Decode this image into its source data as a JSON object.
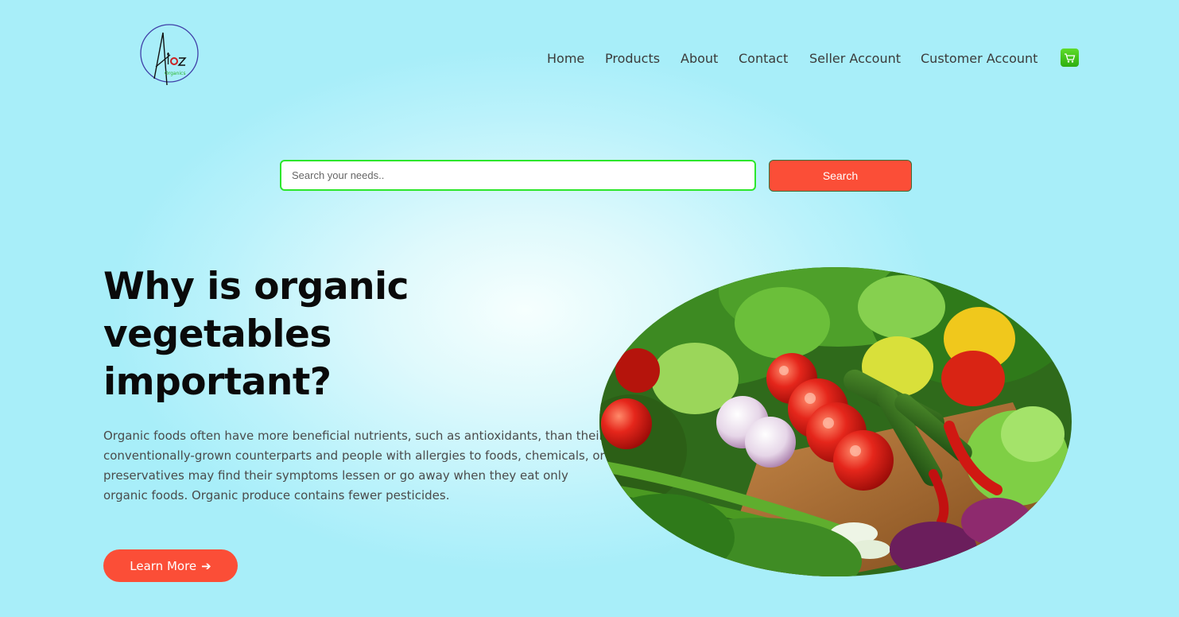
{
  "brand": {
    "logo_main": "Atoz",
    "logo_sub": "Organics"
  },
  "nav": {
    "items": [
      {
        "label": "Home"
      },
      {
        "label": "Products"
      },
      {
        "label": "About"
      },
      {
        "label": "Contact"
      },
      {
        "label": "Seller Account"
      },
      {
        "label": "Customer Account"
      }
    ],
    "cart_icon": "shopping-cart-icon"
  },
  "search": {
    "placeholder": "Search your needs..",
    "value": "",
    "button_label": "Search"
  },
  "hero": {
    "title": "Why is organic vegetables important?",
    "paragraph": "Organic foods often have more beneficial nutrients, such as antioxidants, than their conventionally-grown counterparts and people with allergies to foods, chemicals, or preservatives may find their symptoms lessen or go away when they eat only organic foods. Organic produce contains fewer pesticides.",
    "button_label": "Learn More",
    "button_arrow": "➔"
  },
  "colors": {
    "accent": "#fb4e37",
    "search_border": "#2ce62c",
    "cart_green": "#3fc31a",
    "background": "#a8eef9"
  }
}
